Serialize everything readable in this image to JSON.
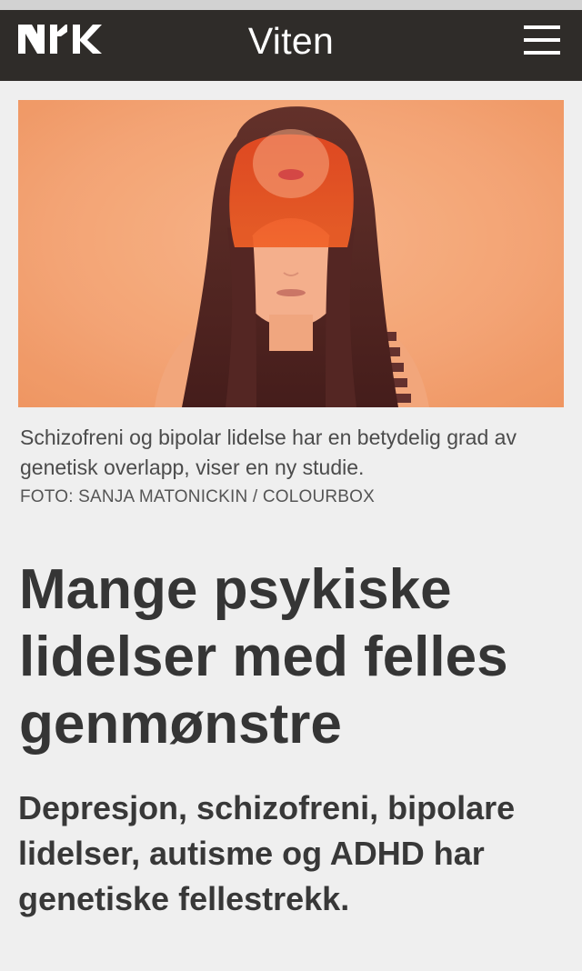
{
  "header": {
    "logo_text": "NRK",
    "section_title": "Viten",
    "menu_icon": "hamburger-menu-icon",
    "background_color": "#2f2c29"
  },
  "hero_image": {
    "alt": "Kvinne med langt mørkt hår og rød lugg, ansiktet dobbelteksponert, mot oransje bakgrunn",
    "dominant_color": "#f4a070"
  },
  "article": {
    "caption": "Schizofreni og bipolar lidelse har en betydelig grad av genetisk overlapp, viser en ny studie.",
    "photo_credit": "FOTO: SANJA MATONICKIN / COLOURBOX",
    "headline": "Mange psykiske lidelser med felles genmønstre",
    "lead": "Depresjon, schizofreni, bipolare lidelser, autisme og ADHD har genetiske fellestrekk."
  }
}
